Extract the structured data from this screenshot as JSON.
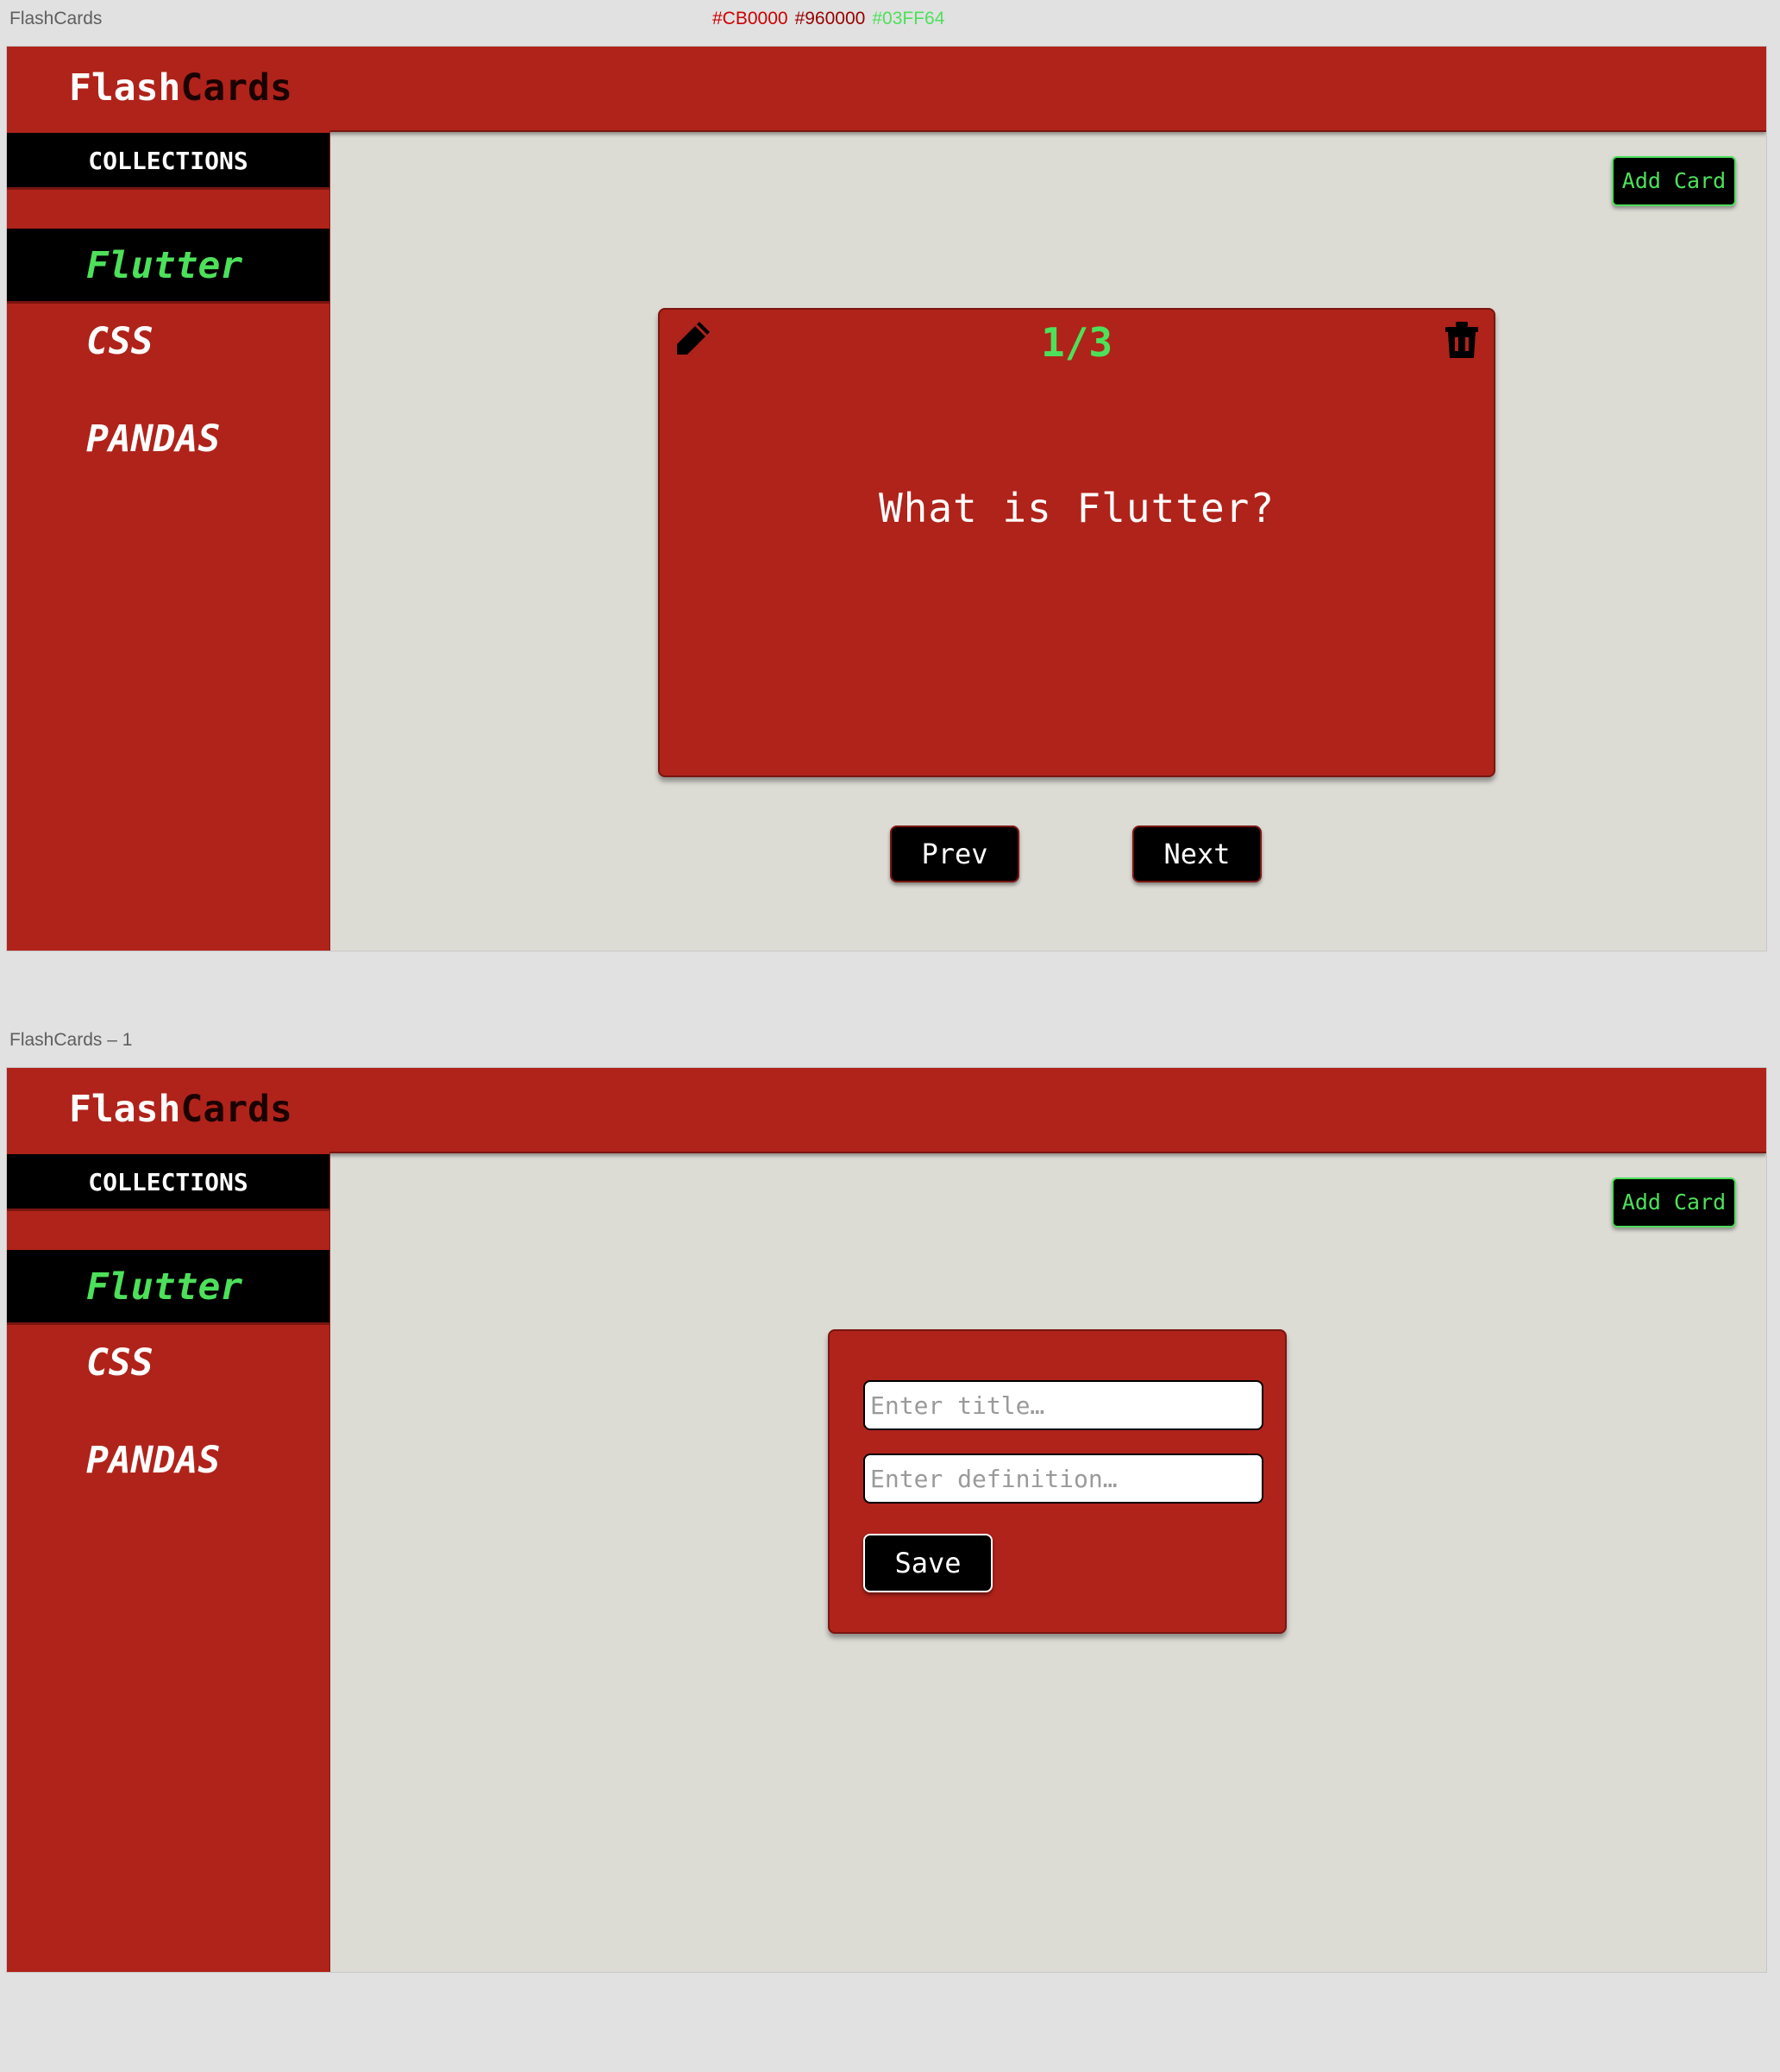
{
  "artboards": [
    {
      "label": "FlashCards"
    },
    {
      "label": "FlashCards – 1"
    }
  ],
  "swatches": [
    {
      "text": "#CB0000",
      "color": "#CB0000"
    },
    {
      "text": "#960000",
      "color": "#960000"
    },
    {
      "text": "#03FF64",
      "color": "#4de05a"
    }
  ],
  "brand": {
    "part1": "Flash",
    "part2": "Cards"
  },
  "sidebar": {
    "heading": "COLLECTIONS",
    "items": [
      {
        "label": "Flutter",
        "active": true
      },
      {
        "label": "CSS",
        "active": false
      },
      {
        "label": "PANDAS",
        "active": false
      }
    ]
  },
  "add_card_label": "Add Card",
  "card": {
    "counter": "1/3",
    "question": "What is Flutter?",
    "edit_icon": "pencil-icon",
    "delete_icon": "trash-icon"
  },
  "pager": {
    "prev_label": "Prev",
    "next_label": "Next"
  },
  "form": {
    "title_placeholder": "Enter title…",
    "definition_placeholder": "Enter definition…",
    "save_label": "Save"
  },
  "colors": {
    "primary_red": "#b0231a",
    "dark_red": "#7a1510",
    "accent_green": "#4de05a",
    "background": "#dcdbd4"
  }
}
